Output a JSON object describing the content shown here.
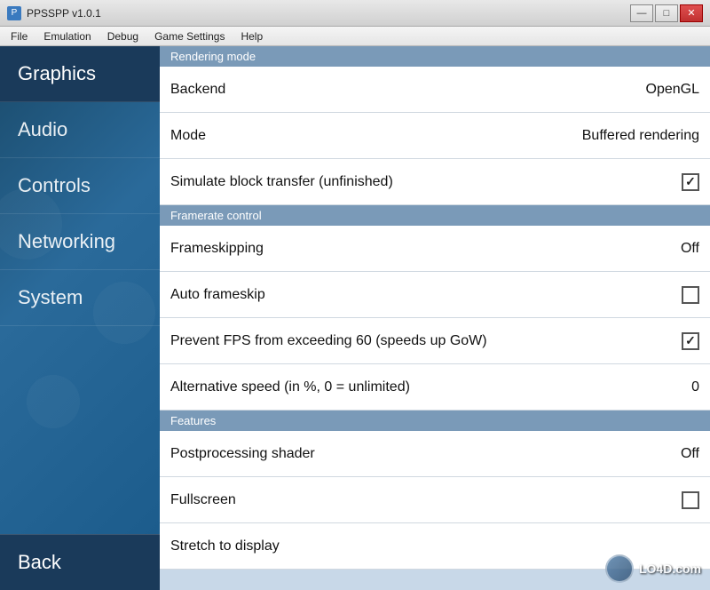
{
  "window": {
    "title": "PPSSPP v1.0.1",
    "icon_label": "P"
  },
  "title_buttons": {
    "minimize": "—",
    "maximize": "□",
    "close": "✕"
  },
  "menu": {
    "items": [
      "File",
      "Emulation",
      "Debug",
      "Game Settings",
      "Help"
    ]
  },
  "sidebar": {
    "items": [
      {
        "label": "Graphics",
        "active": true
      },
      {
        "label": "Audio",
        "active": false
      },
      {
        "label": "Controls",
        "active": false
      },
      {
        "label": "Networking",
        "active": false
      },
      {
        "label": "System",
        "active": false
      }
    ],
    "back_label": "Back"
  },
  "sections": [
    {
      "header": "Rendering mode",
      "settings": [
        {
          "label": "Backend",
          "value": "OpenGL",
          "type": "value"
        },
        {
          "label": "Mode",
          "value": "Buffered rendering",
          "type": "value"
        },
        {
          "label": "Simulate block transfer (unfinished)",
          "value": "",
          "type": "checkbox",
          "checked": true
        }
      ]
    },
    {
      "header": "Framerate control",
      "settings": [
        {
          "label": "Frameskipping",
          "value": "Off",
          "type": "value"
        },
        {
          "label": "Auto frameskip",
          "value": "",
          "type": "checkbox",
          "checked": false
        },
        {
          "label": "Prevent FPS from exceeding 60 (speeds up GoW)",
          "value": "",
          "type": "checkbox",
          "checked": true
        },
        {
          "label": "Alternative speed (in %, 0 = unlimited)",
          "value": "0",
          "type": "value"
        }
      ]
    },
    {
      "header": "Features",
      "settings": [
        {
          "label": "Postprocessing shader",
          "value": "Off",
          "type": "value"
        },
        {
          "label": "Fullscreen",
          "value": "",
          "type": "checkbox",
          "checked": false
        },
        {
          "label": "Stretch to display",
          "value": "",
          "type": "value"
        }
      ]
    }
  ],
  "watermark": {
    "text": "LO4D.com"
  }
}
